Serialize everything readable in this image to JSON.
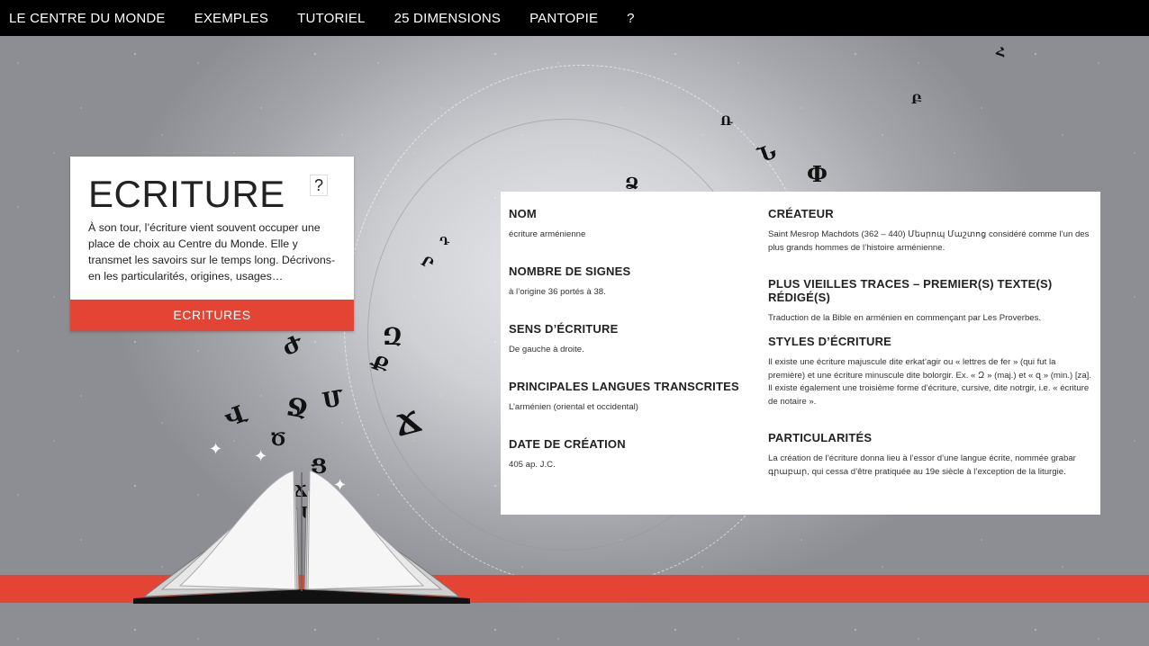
{
  "nav": {
    "items": [
      {
        "label": "LE CENTRE DU MONDE"
      },
      {
        "label": "EXEMPLES"
      },
      {
        "label": "TUTORIEL"
      },
      {
        "label": "25 DIMENSIONS"
      },
      {
        "label": "PANTOPIE"
      },
      {
        "label": "?"
      }
    ]
  },
  "intro": {
    "title": "ECRITURE",
    "help_label": "?",
    "text": "À son tour, l’écriture vient souvent occuper une place de choix au Centre du Monde. Elle y transmet les savoirs sur le temps long. Décrivons-en les particularités, origines, usages…",
    "button_label": "ECRITURES"
  },
  "info": {
    "nom": {
      "label": "NOM",
      "value": "écriture arménienne"
    },
    "signes": {
      "label": "NOMBRE DE SIGNES",
      "value": "à l’origine 36 portés à 38."
    },
    "sens": {
      "label": "SENS D’ÉCRITURE",
      "value": "De gauche à droite."
    },
    "langues": {
      "label": "PRINCIPALES LANGUES TRANSCRITES",
      "value": "L’arménien (oriental et occidental)"
    },
    "date": {
      "label": "DATE DE CRÉATION",
      "value": "405 ap. J.C."
    },
    "createur": {
      "label": "CRÉATEUR",
      "value": "Saint Mesrop Machdots (362 – 440) Մեսրոպ Մաշտոց considéré comme l’un des plus grands hommes de l’histoire arménienne."
    },
    "traces": {
      "label": "PLUS VIEILLES TRACES – PREMIER(S) TEXTE(S) RÉDIGÉ(S)",
      "value": "Traduction de la Bible en arménien en commençant par Les Proverbes."
    },
    "styles": {
      "label": "STYLES D’ÉCRITURE",
      "value": "Il existe une écriture majuscule dite erkat’agir ou « lettres de fer » (qui fut la première) et une écriture minuscule dite bolorgir. Ex. « Զ » (maj.) et « զ » (min.) [za]. Il existe également une troisième forme d’écriture, cursive, dite notrgir, i.e. « écriture de notaire »."
    },
    "particularites": {
      "label": "PARTICULARITÉS",
      "value": "La création de l’écriture donna lieu à l’essor d’une langue écrite, nommée grabar գրաբար, qui cessa d’être pratiquée au 19e siècle à l’exception de la liturgie."
    }
  },
  "colors": {
    "accent": "#e34434",
    "nav_bg": "#000000",
    "panel_bg": "#ffffff"
  },
  "decor": {
    "glyphs": [
      "Վ",
      "Ջ",
      "Ծ",
      "Ճ",
      "Մ",
      "Ց",
      "Ք",
      "Ժ",
      "Զ",
      "Ր",
      "Դ",
      "Ռ",
      "Ն",
      "Փ",
      "Ձ",
      "Հ",
      "Բ"
    ],
    "illustration": "open-book-icon"
  }
}
